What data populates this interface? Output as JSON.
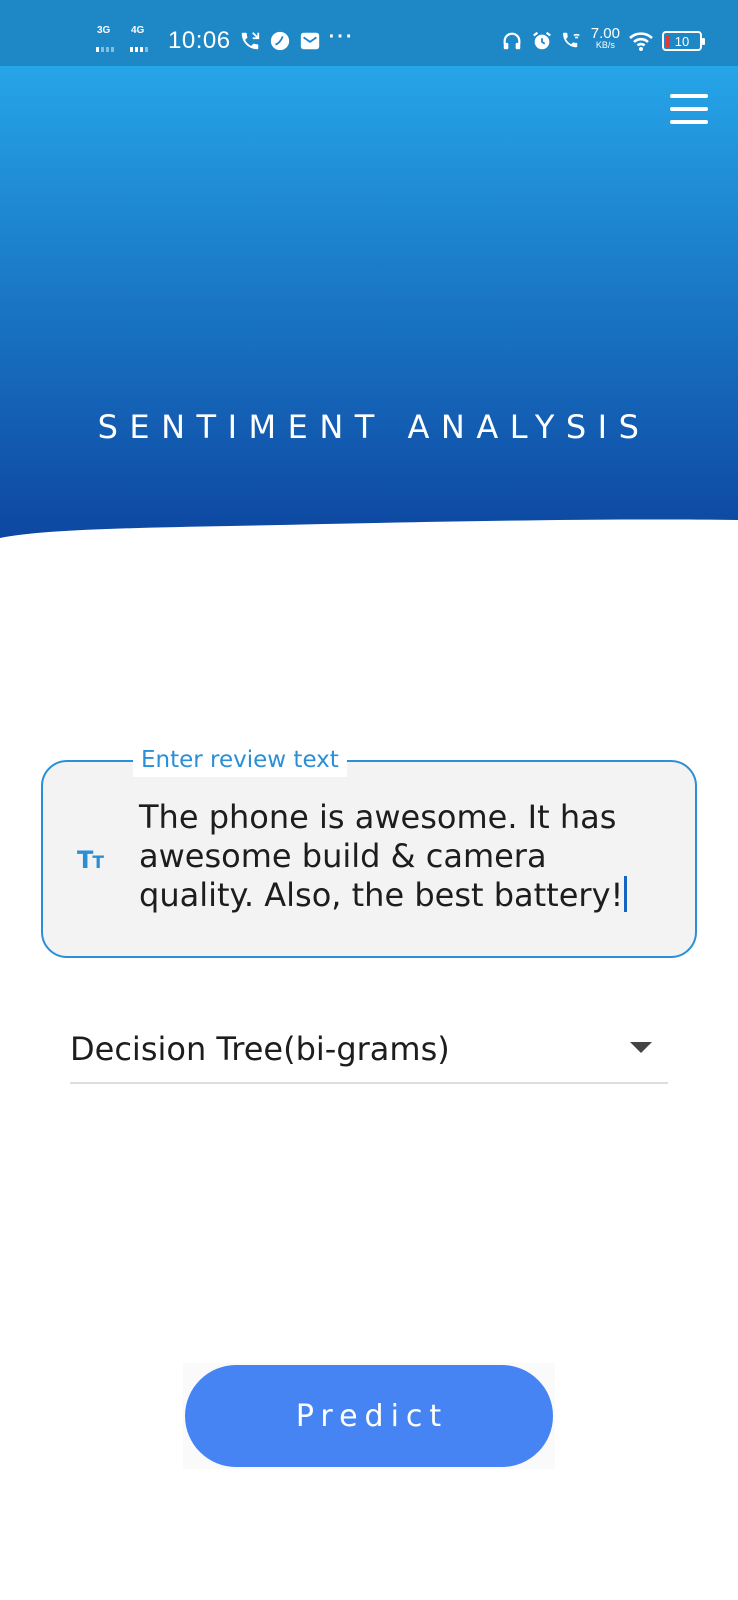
{
  "status_bar": {
    "net1_label": "3G",
    "net2_label": "4G",
    "time": "10:06",
    "speed_value": "7.00",
    "speed_unit": "KB/s",
    "battery_level": "10",
    "icons": [
      "call-icon",
      "leaf-icon",
      "mail-icon",
      "more-dots-icon",
      "headphones-icon",
      "alarm-icon",
      "wifi-call-icon",
      "wifi-icon",
      "battery-icon"
    ]
  },
  "header": {
    "title": "SENTIMENT ANALYSIS",
    "gradient_top": "#26a5e8",
    "gradient_bottom": "#0d47a1",
    "menu_icon": "hamburger-menu-icon"
  },
  "review": {
    "label": "Enter review text",
    "value": "The phone is awesome. It has awesome build & camera quality. Also, the best battery!",
    "icon": "text-size-icon",
    "icon_glyph_big": "T",
    "icon_glyph_small": "T",
    "accent": "#2b8fd6"
  },
  "model": {
    "selected": "Decision Tree(bi-grams)",
    "icon": "dropdown-arrow-icon"
  },
  "predict": {
    "label": "Predict",
    "color": "#4584f2"
  }
}
